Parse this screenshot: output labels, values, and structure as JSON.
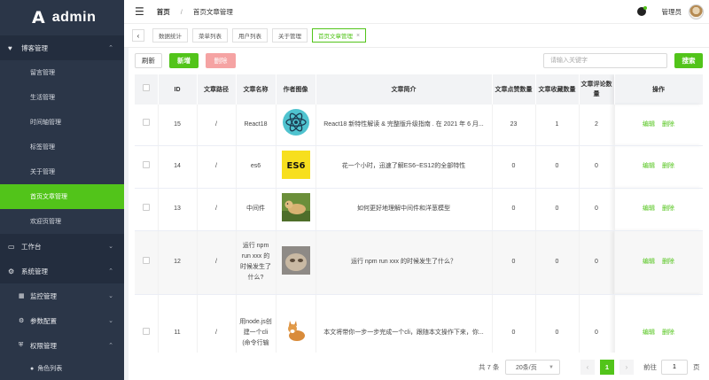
{
  "app": {
    "logo_mark": "A",
    "name": "admin"
  },
  "sidebar": {
    "group_blog": {
      "label": "博客管理",
      "icon": "heart-icon"
    },
    "blog_items": [
      "留言管理",
      "生活管理",
      "时间轴管理",
      "标签管理",
      "关于管理",
      "首页文章管理",
      "欢迎页管理"
    ],
    "active_item": "首页文章管理",
    "group_workbench": {
      "label": "工作台",
      "icon": "monitor-icon"
    },
    "group_system": {
      "label": "系统管理",
      "icon": "gear-icon"
    },
    "system_items": [
      {
        "label": "监控管理",
        "icon": "chart-icon"
      },
      {
        "label": "参数配置",
        "icon": "gear-icon"
      },
      {
        "label": "权限管理",
        "icon": "shield-icon"
      }
    ],
    "perm_sub": {
      "label": "角色列表"
    }
  },
  "header": {
    "breadcrumb_home": "首页",
    "breadcrumb_current": "首页文章管理",
    "user_name": "管理员"
  },
  "tags": [
    "数据统计",
    "菜单列表",
    "用户列表",
    "关于管理",
    "首页文章管理"
  ],
  "toolbar": {
    "refresh": "刷新",
    "add": "新增",
    "delete": "删除",
    "search_placeholder": "请输入关键字",
    "search": "搜索"
  },
  "table": {
    "headers": [
      "",
      "ID",
      "文章路径",
      "文章名称",
      "作者图像",
      "文章简介",
      "文章点赞数量",
      "文章收藏数量",
      "文章评论数量",
      "操作"
    ],
    "rows": [
      {
        "id": "15",
        "path": "/",
        "name": "React18",
        "image": "react-logo",
        "intro": "React18 新特性解读 & 完整版升级指南 . 在 2021 年 6 月...",
        "likes": "23",
        "collects": "1",
        "comments": "2"
      },
      {
        "id": "14",
        "path": "/",
        "name": "es6",
        "image": "es6-logo",
        "intro": "花一个小时，迅速了解ES6~ES12的全部特性",
        "likes": "0",
        "collects": "0",
        "comments": "0"
      },
      {
        "id": "13",
        "path": "/",
        "name": "中间件",
        "image": "dog-photo",
        "intro": "如何更好地理解中间件和洋葱模型",
        "likes": "0",
        "collects": "0",
        "comments": "0"
      },
      {
        "id": "12",
        "path": "/",
        "name": "运行 npm run xxx 的时候发生了什么?",
        "image": "cat-photo",
        "intro": "运行 npm run xxx 的时候发生了什么？",
        "likes": "0",
        "collects": "0",
        "comments": "0"
      },
      {
        "id": "11",
        "path": "/",
        "name": "用node.js创建一个cli (命令行输",
        "image": "corgi-photo",
        "intro": "本文将带你一步一步完成一个cli，跟随本文操作下来，你...",
        "likes": "0",
        "collects": "0",
        "comments": "0"
      }
    ],
    "op_edit": "编辑",
    "op_delete": "删除"
  },
  "pagination": {
    "total": "共 7 条",
    "page_size": "20条/页",
    "prev": "‹",
    "current": "1",
    "next": "›",
    "goto_label": "前往",
    "goto_value": "1",
    "goto_unit": "页"
  },
  "colors": {
    "accent": "#52c41a",
    "sidebar_bg": "#2b3648",
    "danger_light": "#f5a3a3"
  }
}
